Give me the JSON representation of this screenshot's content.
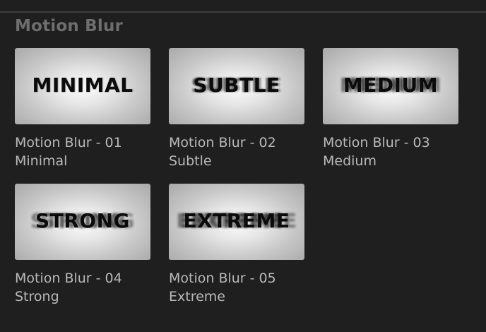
{
  "section": {
    "title": "Motion Blur"
  },
  "presets": [
    {
      "thumb_text": "MINIMAL",
      "name_line1": "Motion Blur - 01",
      "name_line2": "Minimal"
    },
    {
      "thumb_text": "SUBTLE",
      "name_line1": "Motion Blur - 02",
      "name_line2": "Subtle"
    },
    {
      "thumb_text": "MEDIUM",
      "name_line1": "Motion Blur - 03",
      "name_line2": "Medium"
    },
    {
      "thumb_text": "STRONG",
      "name_line1": "Motion Blur - 04",
      "name_line2": "Strong"
    },
    {
      "thumb_text": "EXTREME",
      "name_line1": "Motion Blur - 05",
      "name_line2": "Extreme"
    }
  ],
  "colors": {
    "background": "#1f1f1f",
    "section_title": "#6e6e6e",
    "caption_text": "#b9b9b9",
    "thumb_text": "#0b0b0b"
  }
}
